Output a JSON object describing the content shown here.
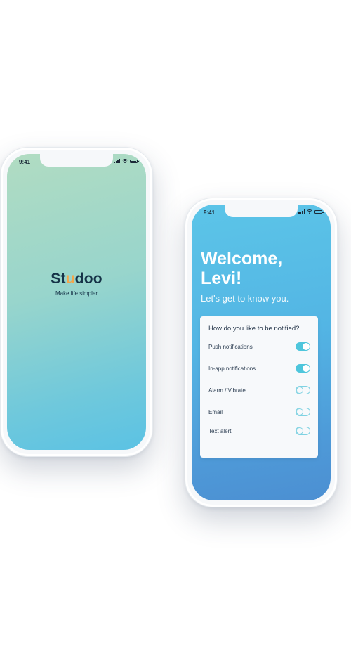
{
  "splash_screen": {
    "status_time": "9:41",
    "logo": {
      "part1": "St",
      "part2": "u",
      "part3": "doo"
    },
    "tagline": "Make life simpler"
  },
  "welcome_screen": {
    "status_time": "9:41",
    "title_line1": "Welcome,",
    "title_line2": "Levi!",
    "subtitle": "Let's get to know you.",
    "card": {
      "question": "How do you like to be notified?",
      "options": [
        {
          "label": "Push notifications",
          "enabled": true
        },
        {
          "label": "In-app notifications",
          "enabled": true
        },
        {
          "label": "Alarm / Vibrate",
          "enabled": false
        },
        {
          "label": "Email",
          "enabled": false
        },
        {
          "label": "Text alert",
          "enabled": false
        }
      ]
    }
  },
  "colors": {
    "brand_navy": "#153247",
    "brand_orange": "#f3a64a",
    "toggle_on": "#4ec6dc"
  }
}
